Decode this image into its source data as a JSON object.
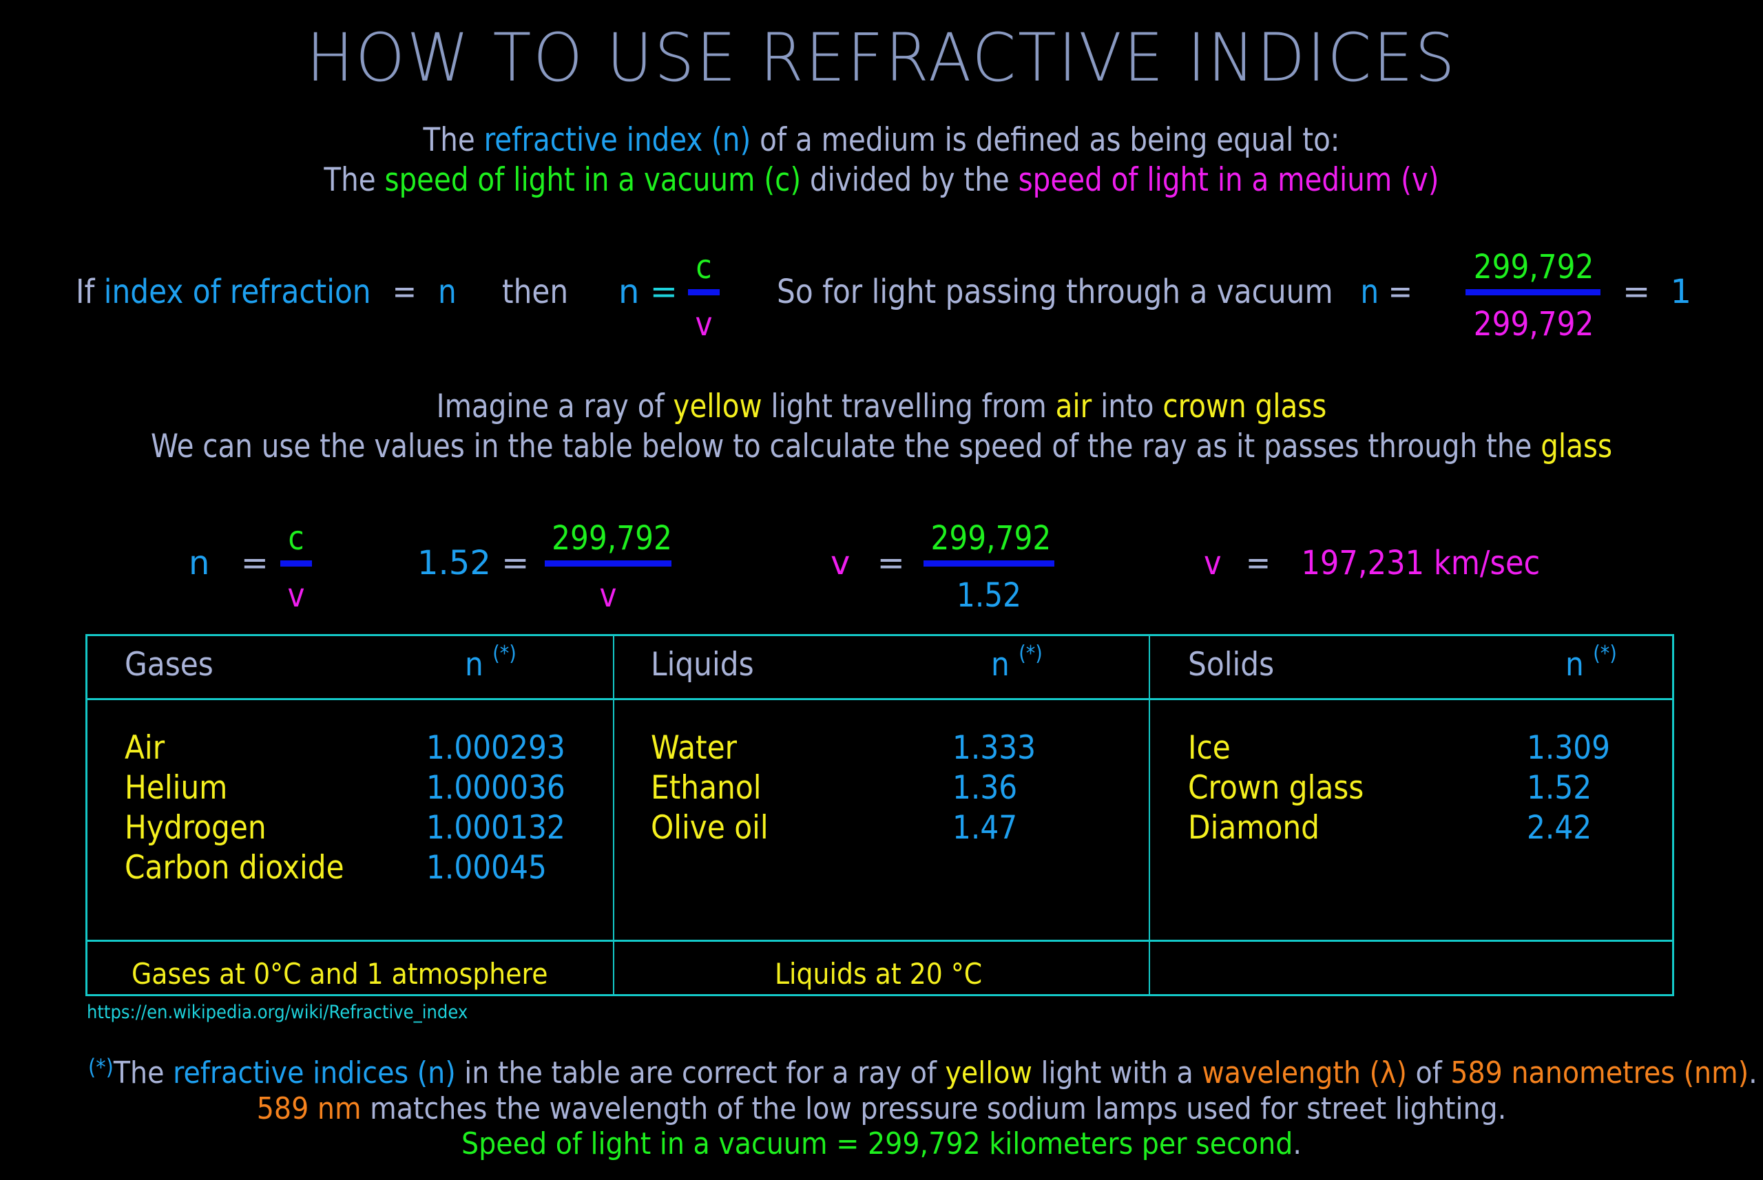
{
  "title": "HOW TO USE REFRACTIVE INDICES",
  "definition": {
    "line1": {
      "p1": "The ",
      "p2": "refractive index (n)",
      "p3": " of a medium is defined as being equal to:"
    },
    "line2": {
      "p1": "The ",
      "p2": "speed of light in a vacuum (c)",
      "p3": " divided by the ",
      "p4": "speed of light in a medium (v)"
    }
  },
  "formula": {
    "if": "If ",
    "index_label": "index of refraction",
    "eq": "=",
    "n": "n",
    "then": "then",
    "c": "c",
    "v": "v",
    "vacuum_text": "So for light passing through a vacuum",
    "vacuum_num": "299,792",
    "vacuum_den": "299,792",
    "result": "1"
  },
  "imagine": {
    "line1": {
      "p1": "Imagine a ray of ",
      "p2": "yellow",
      "p3": " light travelling from ",
      "p4": "air",
      "p5": " into ",
      "p6": "crown glass"
    },
    "line2": {
      "p1": "We can use the values in the table below to calculate the speed of the ray as it passes through the ",
      "p2": "glass"
    }
  },
  "calculation": {
    "step1": {
      "lhs": "n",
      "eq": "=",
      "num": "c",
      "den": "v"
    },
    "step2": {
      "lhs": "1.52",
      "eq": "=",
      "num": "299,792",
      "den": "v"
    },
    "step3": {
      "lhs": "v",
      "eq": "=",
      "num": "299,792",
      "den": "1.52"
    },
    "step4": {
      "lhs": "v",
      "eq": "=",
      "result": "197,231 km/sec"
    }
  },
  "table": {
    "columns": [
      {
        "header": "Gases",
        "n_label": "n",
        "n_sup": "(*)",
        "rows": [
          {
            "name": "Air",
            "n": "1.000293"
          },
          {
            "name": "Helium",
            "n": "1.000036"
          },
          {
            "name": "Hydrogen",
            "n": "1.000132"
          },
          {
            "name": "Carbon dioxide",
            "n": "1.00045"
          }
        ],
        "footer": "Gases at 0°C and 1 atmosphere"
      },
      {
        "header": "Liquids",
        "n_label": "n",
        "n_sup": "(*)",
        "rows": [
          {
            "name": "Water",
            "n": "1.333"
          },
          {
            "name": "Ethanol",
            "n": "1.36"
          },
          {
            "name": "Olive oil",
            "n": "1.47"
          }
        ],
        "footer": "Liquids at 20 °C"
      },
      {
        "header": "Solids",
        "n_label": "n",
        "n_sup": "(*)",
        "rows": [
          {
            "name": "Ice",
            "n": "1.309"
          },
          {
            "name": "Crown glass",
            "n": "1.52"
          },
          {
            "name": "Diamond",
            "n": "2.42"
          }
        ],
        "footer": ""
      }
    ]
  },
  "source_url": "https://en.wikipedia.org/wiki/Refractive_index",
  "footnote": {
    "line1": {
      "mark": "(*)",
      "p1": "The ",
      "p2": "refractive indices (n)",
      "p3": " in the table are correct for a ray of ",
      "p4": "yellow",
      "p5": " light with a  ",
      "p6": "wavelength (λ)",
      "p7": " of ",
      "p8": "589 nanometres (nm)",
      "p9": "."
    },
    "line2": {
      "p1": "589 nm",
      "p2": " matches the wavelength of the low pressure sodium lamps used for street lighting."
    },
    "line3": {
      "p1": "Speed of light in a vacuum  =  299,792 kilometers per second",
      "p2": "."
    }
  },
  "colors": {
    "title": "#8a9ac2",
    "text": "#a9b3d8",
    "blue": "#1ea0f0",
    "green": "#1ef01e",
    "magenta": "#f01ef0",
    "yellow": "#f5f01e",
    "orange": "#f5821e",
    "cyan": "#1ed2dc",
    "fraction_bar": "#0a14f0",
    "table_border": "#14c8c8"
  }
}
